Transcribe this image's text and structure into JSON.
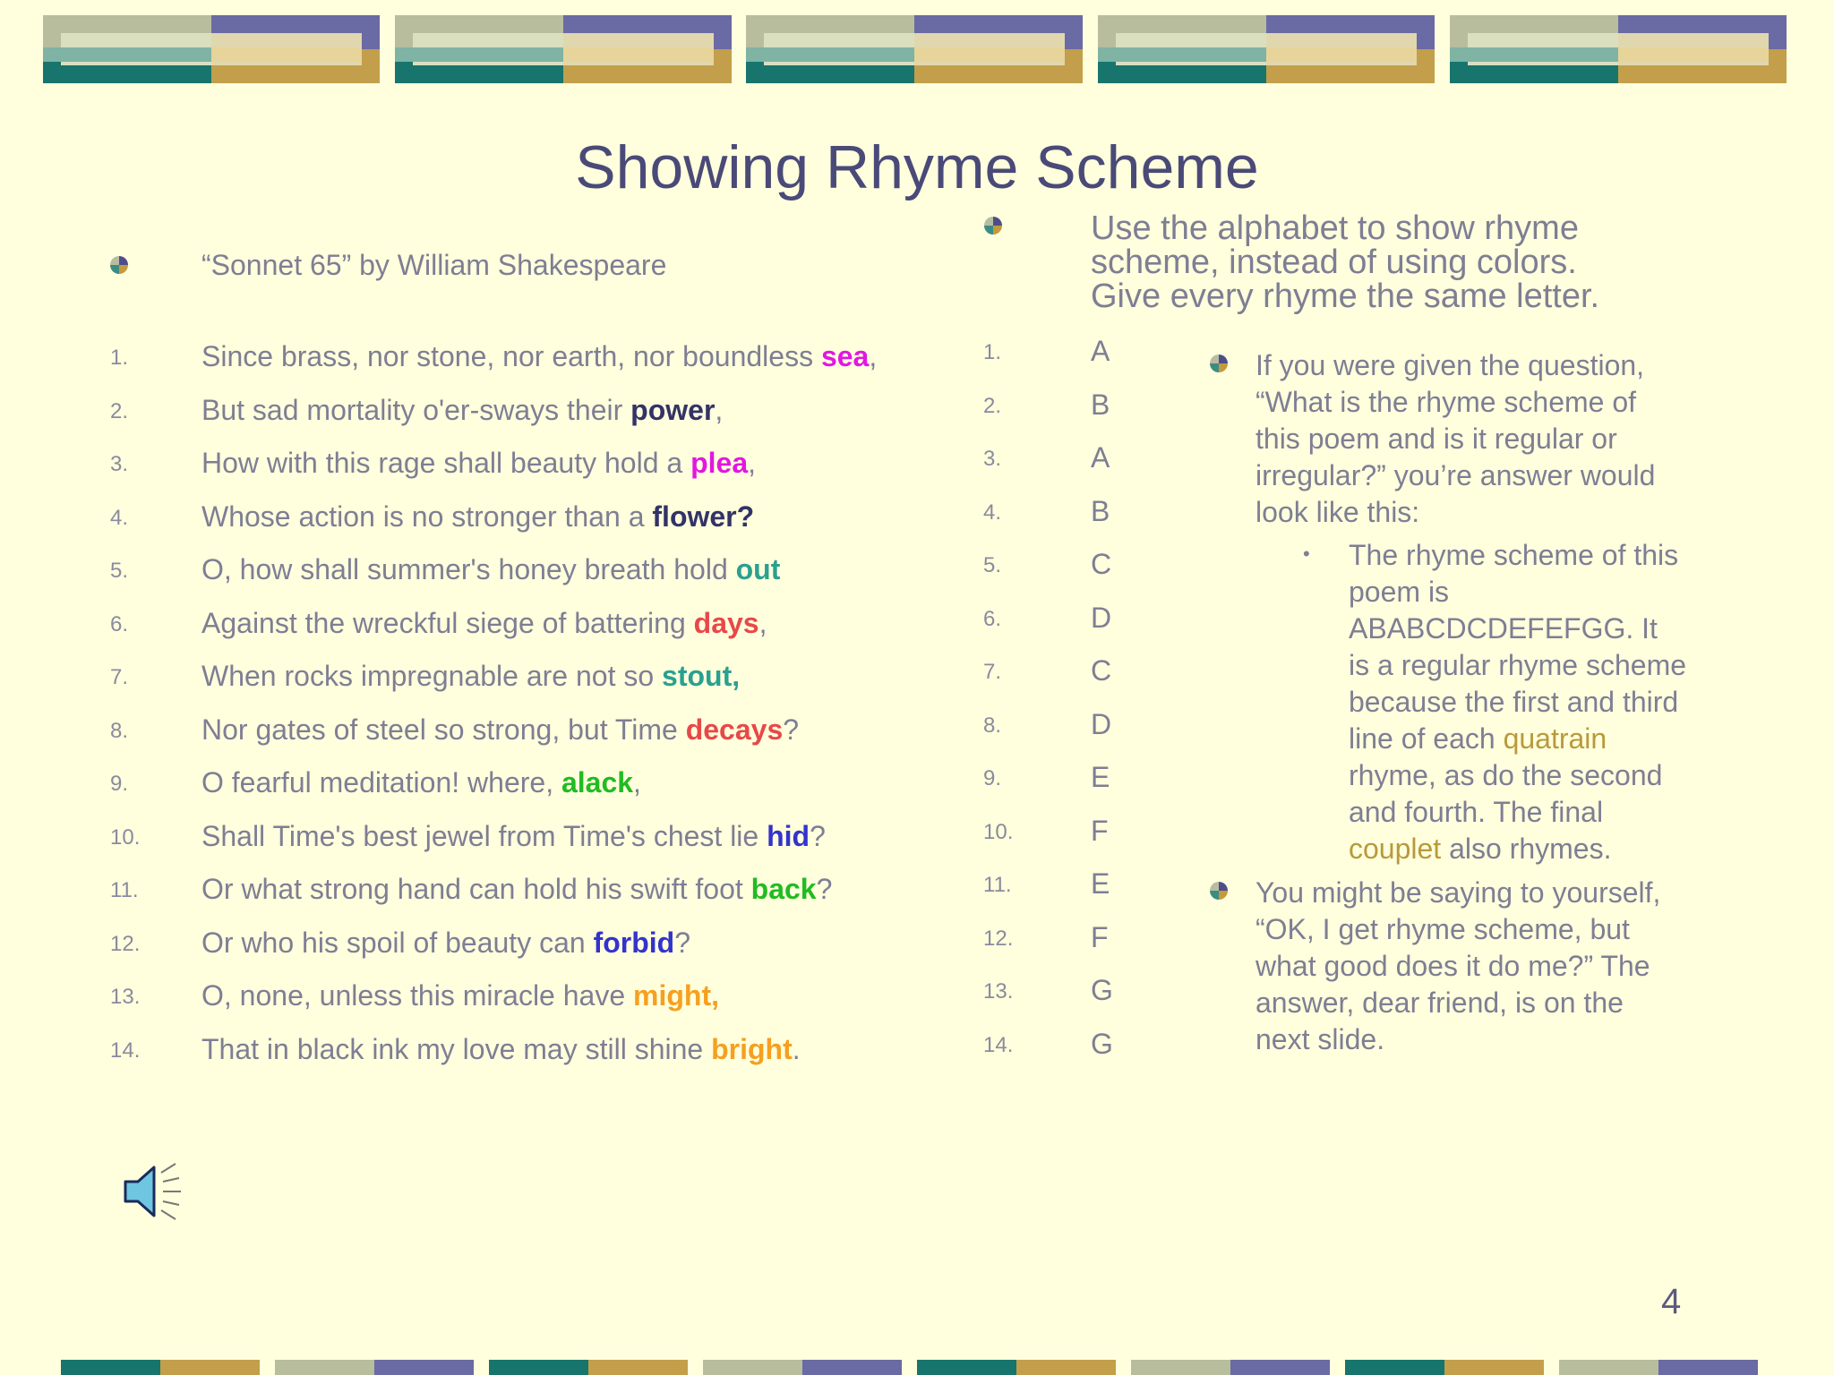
{
  "title": "Showing Rhyme Scheme",
  "colors": {
    "background": "#ffffdd",
    "title": "#4a4a78",
    "body_text": "#7e7e94",
    "magenta": "#e018e0",
    "navy": "#333366",
    "teal": "#2aa090",
    "red": "#e84848",
    "green": "#22bb22",
    "blue": "#3333cc",
    "orange": "#f5a020",
    "gold": "#b89a3c"
  },
  "left": {
    "bullet_text": "“Sonnet 65” by William Shakespeare",
    "lines": [
      {
        "num": "1.",
        "before": "Since brass, nor stone, nor earth, nor boundless ",
        "word": "sea",
        "after": ",",
        "color": "#e018e0"
      },
      {
        "num": "2.",
        "before": "But sad mortality o'er-sways their ",
        "word": "power",
        "after": ",",
        "color": "#333366"
      },
      {
        "num": "3.",
        "before": "How with this rage shall beauty hold a ",
        "word": "plea",
        "after": ",",
        "color": "#e018e0"
      },
      {
        "num": "4.",
        "before": "Whose action is no stronger than a ",
        "word": "flower?",
        "after": "",
        "color": "#333366"
      },
      {
        "num": "5.",
        "before": "O, how shall summer's honey breath hold ",
        "word": "out",
        "after": "",
        "color": "#2aa090"
      },
      {
        "num": "6.",
        "before": "Against the wreckful siege of battering ",
        "word": "days",
        "after": ",",
        "color": "#e84848"
      },
      {
        "num": "7.",
        "before": "When rocks impregnable are not so ",
        "word": "stout,",
        "after": "",
        "color": "#2aa090"
      },
      {
        "num": "8.",
        "before": "Nor gates of steel so strong, but Time ",
        "word": "decays",
        "after": "?",
        "color": "#e84848"
      },
      {
        "num": "9.",
        "before": "O fearful meditation! where, ",
        "word": "alack",
        "after": ",",
        "color": "#22bb22"
      },
      {
        "num": "10.",
        "before": "Shall Time's best jewel from Time's chest lie ",
        "word": "hid",
        "after": "?",
        "color": "#3333cc"
      },
      {
        "num": "11.",
        "before": "Or what strong hand can hold his swift foot ",
        "word": "back",
        "after": "?",
        "color": "#22bb22"
      },
      {
        "num": "12.",
        "before": "Or who his spoil of beauty can ",
        "word": "forbid",
        "after": "?",
        "color": "#3333cc"
      },
      {
        "num": "13.",
        "before": "O, none, unless this miracle have ",
        "word": "might,",
        "after": "",
        "color": "#f5a020"
      },
      {
        "num": "14.",
        "before": "That in black ink my love may still shine ",
        "word": "bright",
        "after": ".",
        "color": "#f5a020"
      }
    ]
  },
  "middle": {
    "heading": [
      "Use the alphabet to show rhyme",
      "scheme, instead of using colors.",
      "Give every rhyme the same letter."
    ],
    "items": [
      {
        "num": "1.",
        "letter": "A"
      },
      {
        "num": "2.",
        "letter": "B"
      },
      {
        "num": "3.",
        "letter": "A"
      },
      {
        "num": "4.",
        "letter": "B"
      },
      {
        "num": "5.",
        "letter": "C"
      },
      {
        "num": "6.",
        "letter": "D"
      },
      {
        "num": "7.",
        "letter": "C"
      },
      {
        "num": "8.",
        "letter": "D"
      },
      {
        "num": "9.",
        "letter": "E"
      },
      {
        "num": "10.",
        "letter": "F"
      },
      {
        "num": "11.",
        "letter": "E"
      },
      {
        "num": "12.",
        "letter": "F"
      },
      {
        "num": "13.",
        "letter": "G"
      },
      {
        "num": "14.",
        "letter": "G"
      }
    ]
  },
  "right": {
    "bullet1": [
      "If you were given the question,",
      "“What is the rhyme scheme of",
      "this poem and is it regular or",
      "irregular?” you’re answer would",
      "look like this:"
    ],
    "sub_bullet": {
      "l1": "The rhyme scheme of this",
      "l2": "poem is",
      "l3": "ABABCDCDEFEFGG.  It",
      "l4": "is a regular rhyme scheme",
      "l5": "because the first and third",
      "l6_pre": "line of each ",
      "l6_kw": "quatrain",
      "l7": "rhyme, as do the second",
      "l8": "and fourth.  The final",
      "l9_kw": "couplet",
      "l9_post": " also rhymes."
    },
    "bullet2": [
      "You might be saying to yourself,",
      "“OK, I get rhyme scheme, but",
      "what good does it do me?”  The",
      "answer, dear friend, is on the",
      "next slide."
    ]
  },
  "sound_icon": "speaker-icon",
  "page_number": "4"
}
